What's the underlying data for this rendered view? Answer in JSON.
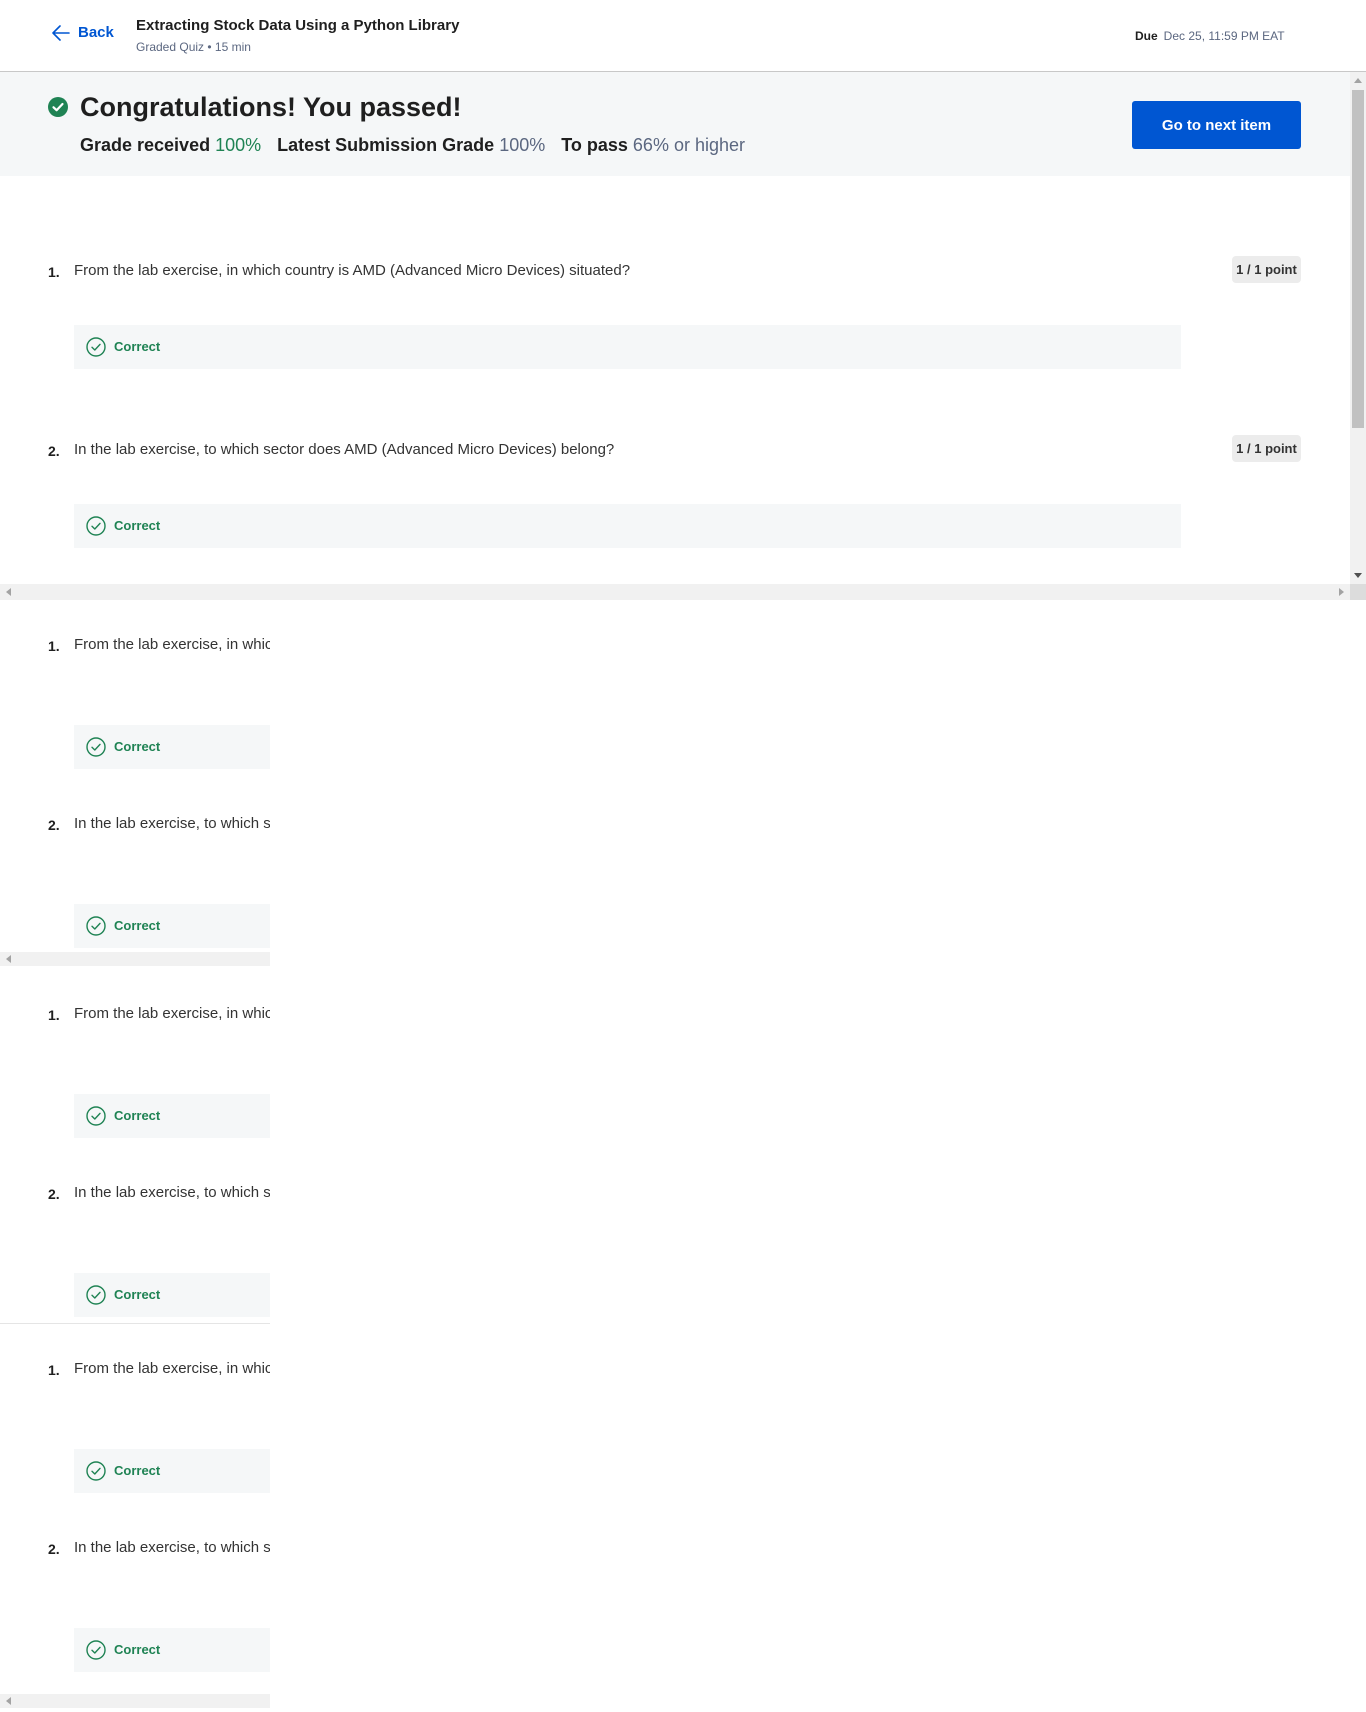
{
  "header": {
    "back_label": "Back",
    "title": "Extracting Stock Data Using a Python Library",
    "subtitle": "Graded Quiz • 15 min",
    "due_label": "Due",
    "due_value": "Dec 25, 11:59 PM EAT"
  },
  "banner": {
    "heading": "Congratulations! You passed!",
    "grade_received_label": "Grade received",
    "grade_received_value": "100%",
    "latest_label": "Latest Submission Grade",
    "latest_value": "100%",
    "to_pass_label": "To pass",
    "to_pass_value": "66% or higher",
    "next_button": "Go to next item"
  },
  "questions": [
    {
      "number": "1.",
      "text": "From the lab exercise, in which country is AMD (Advanced Micro Devices) situated?",
      "clipped_text": "From the lab exercise, in whic",
      "points": "1 / 1 point",
      "feedback": "Correct"
    },
    {
      "number": "2.",
      "text": "In the lab exercise, to which sector does AMD (Advanced Micro Devices) belong?",
      "clipped_text": "In the lab exercise, to which se",
      "points": "1 / 1 point",
      "feedback": "Correct"
    }
  ],
  "colors": {
    "accent": "#0056d2",
    "success": "#1f8354",
    "banner_bg": "#f5f7f8"
  },
  "icons": {
    "back": "arrow-left-icon",
    "passed": "check-circle-filled-icon",
    "correct": "check-circle-outline-icon"
  }
}
